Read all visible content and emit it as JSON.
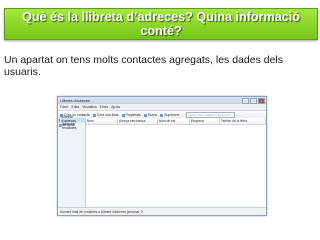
{
  "slide": {
    "title": "Què és la llibreta d’adreces? Quina informació conté?",
    "body": "Un apartat on tens molts contactes agregats, les dades dels usuaris."
  },
  "window": {
    "title": "Llibreta d'adreces",
    "menu": [
      "Fitxer",
      "Edita",
      "Visualitza",
      "Eines",
      "Ajuda"
    ],
    "toolbar": [
      "Crea un contacte",
      "Crea una llista",
      "Propietats",
      "Escriu",
      "Suprimeix"
    ],
    "search_placeholder": "Cerca nom o adreça electrònica",
    "sidebar": [
      "Llibreta d'adreces personal",
      "Adreces recollides"
    ],
    "columns": [
      "Nom",
      "Adreça electrònica",
      "Nom de xat",
      "Empresa",
      "Telèfon de la feina"
    ],
    "status": "Nombre total de contactes a Llibreta d'adreces personal: 0"
  }
}
